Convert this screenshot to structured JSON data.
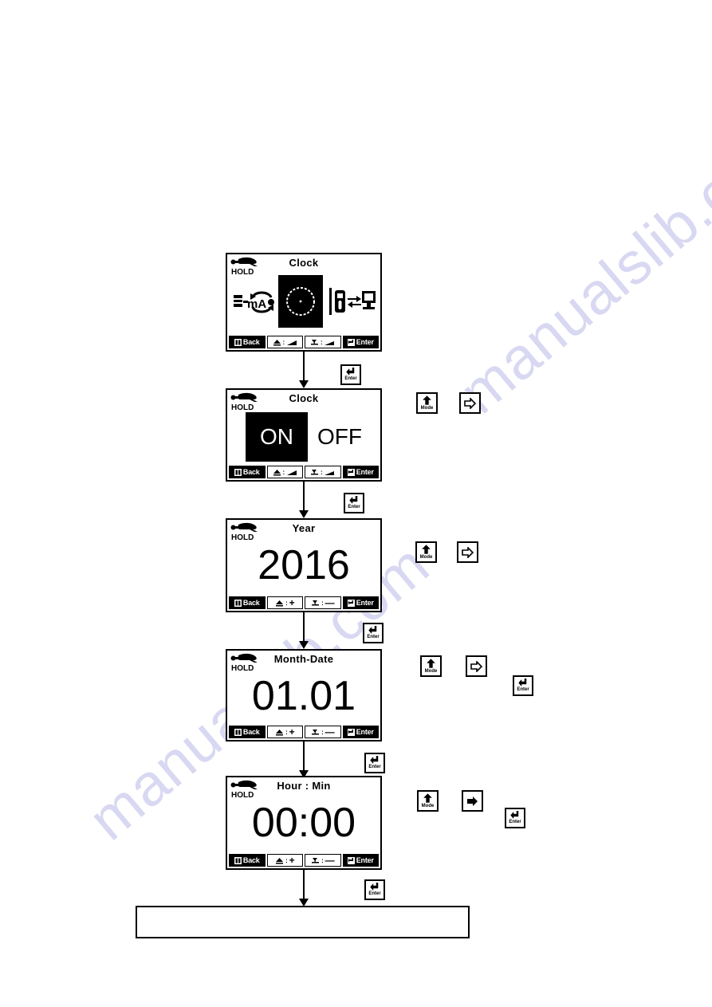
{
  "document": {
    "type": "clock-setting-flow-diagram",
    "watermark_text": "manualslib.com"
  },
  "panels": [
    {
      "id": "clock-menu",
      "title": "Clock",
      "status_icon": "hold-icon",
      "status_label": "HOLD",
      "content_type": "icon-menu",
      "icons": [
        "ma-loop-icon",
        "clock-icon",
        "pc-link-icon"
      ],
      "selected_icon": "clock-icon",
      "ma_label": "mA",
      "softkeys": [
        {
          "label": "Back",
          "prefix_icon": "esc-icon",
          "style": "inverted"
        },
        {
          "label": "",
          "prefix_icon": "up-triangle-icon",
          "suffix_icon": "ramp-up-icon",
          "style": "normal"
        },
        {
          "label": "",
          "prefix_icon": "down-triangle-icon",
          "suffix_icon": "ramp-down-icon",
          "style": "normal"
        },
        {
          "label": "Enter",
          "prefix_icon": "enter-icon",
          "style": "inverted"
        }
      ]
    },
    {
      "id": "clock-onoff",
      "title": "Clock",
      "status_icon": "hold-icon",
      "status_label": "HOLD",
      "content_type": "on-off",
      "option_on": "ON",
      "option_off": "OFF",
      "selected_option": "ON",
      "softkeys": [
        {
          "label": "Back",
          "prefix_icon": "esc-icon",
          "style": "inverted"
        },
        {
          "label": "",
          "prefix_icon": "up-triangle-icon",
          "suffix_icon": "ramp-up-icon",
          "style": "normal"
        },
        {
          "label": "",
          "prefix_icon": "down-triangle-icon",
          "suffix_icon": "ramp-down-icon",
          "style": "normal"
        },
        {
          "label": "Enter",
          "prefix_icon": "enter-icon",
          "style": "inverted"
        }
      ]
    },
    {
      "id": "year",
      "title": "Year",
      "status_icon": "hold-icon",
      "status_label": "HOLD",
      "content_type": "big-value",
      "value": "2016",
      "softkeys": [
        {
          "label": "Back",
          "prefix_icon": "esc-icon",
          "style": "inverted"
        },
        {
          "label": "+",
          "prefix_icon": "up-triangle-icon",
          "style": "normal"
        },
        {
          "label": "—",
          "prefix_icon": "down-triangle-icon",
          "style": "normal"
        },
        {
          "label": "Enter",
          "prefix_icon": "enter-icon",
          "style": "inverted"
        }
      ]
    },
    {
      "id": "month-date",
      "title": "Month-Date",
      "status_icon": "hold-icon",
      "status_label": "HOLD",
      "content_type": "big-value",
      "value": "01.01",
      "softkeys": [
        {
          "label": "Back",
          "prefix_icon": "esc-icon",
          "style": "inverted"
        },
        {
          "label": "+",
          "prefix_icon": "up-triangle-icon",
          "style": "normal"
        },
        {
          "label": "—",
          "prefix_icon": "down-triangle-icon",
          "style": "normal"
        },
        {
          "label": "Enter",
          "prefix_icon": "enter-icon",
          "style": "inverted"
        }
      ]
    },
    {
      "id": "hour-min",
      "title": "Hour : Min",
      "status_icon": "hold-icon",
      "status_label": "HOLD",
      "content_type": "big-value",
      "value": "00:00",
      "softkeys": [
        {
          "label": "Back",
          "prefix_icon": "esc-icon",
          "style": "inverted"
        },
        {
          "label": "+",
          "prefix_icon": "up-triangle-icon",
          "style": "normal"
        },
        {
          "label": "—",
          "prefix_icon": "down-triangle-icon",
          "style": "normal"
        },
        {
          "label": "Enter",
          "prefix_icon": "enter-icon",
          "style": "inverted"
        }
      ]
    }
  ],
  "keys": {
    "mode_label": "Mode",
    "enter_label": "Enter",
    "right_arrow_label": ""
  },
  "flow_keys": [
    {
      "row": 1,
      "key": "enter",
      "label": "Enter"
    },
    {
      "row": 2,
      "key": "mode",
      "label": "Mode"
    },
    {
      "row": 2,
      "key": "right",
      "label": ""
    },
    {
      "row": 2,
      "key": "enter",
      "label": "Enter"
    },
    {
      "row": 3,
      "key": "mode",
      "label": "Mode"
    },
    {
      "row": 3,
      "key": "right",
      "label": ""
    },
    {
      "row": 3,
      "key": "enter",
      "label": "Enter"
    },
    {
      "row": 4,
      "key": "mode",
      "label": "Mode"
    },
    {
      "row": 4,
      "key": "right",
      "label": ""
    },
    {
      "row": 4,
      "key": "enter",
      "label": "Enter"
    },
    {
      "row": 5,
      "key": "mode",
      "label": "Mode"
    },
    {
      "row": 5,
      "key": "right",
      "label": ""
    },
    {
      "row": 5,
      "key": "enter",
      "label": "Enter"
    },
    {
      "row": 6,
      "key": "enter",
      "label": "Enter"
    }
  ],
  "end_box": {
    "text": ""
  }
}
